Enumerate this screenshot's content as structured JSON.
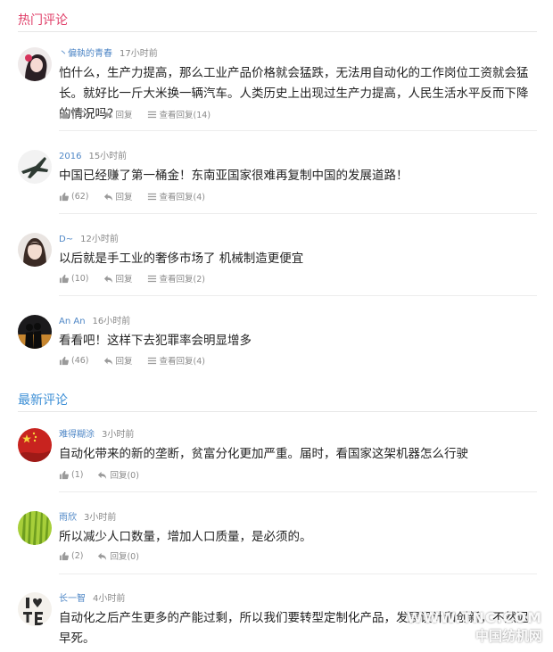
{
  "sections": {
    "hot_title": "热门评论",
    "new_title": "最新评论"
  },
  "labels": {
    "reply": "回复"
  },
  "hot_comments": [
    {
      "username": "丶偏執的青春",
      "time": "17小时前",
      "text": "怕什么，生产力提高，那么工业产品价格就会猛跌，无法用自动化的工作岗位工资就会猛长。就好比一斤大米换一辆汽车。人类历史上出现过生产力提高，人民生活水平反而下降的情况吗？",
      "likes": "(50)",
      "view_replies": "查看回复(14)",
      "avatar_icon": "anime-girl-avatar-icon"
    },
    {
      "username": "2016",
      "time": "15小时前",
      "text": "中国已经赚了第一桶金！东南亚国家很难再复制中国的发展道路！",
      "likes": "(62)",
      "view_replies": "查看回复(4)",
      "avatar_icon": "fighter-jet-avatar-icon"
    },
    {
      "username": "D~",
      "time": "12小时前",
      "text": "以后就是手工业的奢侈市场了 机械制造更便宜",
      "likes": "(10)",
      "view_replies": "查看回复(2)",
      "avatar_icon": "woman-portrait-avatar-icon"
    },
    {
      "username": "An An",
      "time": "16小时前",
      "text": "看看吧！这样下去犯罪率会明显增多",
      "likes": "(46)",
      "view_replies": "查看回复(4)",
      "avatar_icon": "sunset-couple-avatar-icon"
    }
  ],
  "new_comments": [
    {
      "username": "难得糊涂",
      "time": "3小时前",
      "text": "自动化带来的新的垄断，贫富分化更加严重。届时，看国家这架机器怎么行驶",
      "likes": "(1)",
      "replies": "回复(0)",
      "avatar_icon": "china-flag-avatar-icon"
    },
    {
      "username": "雨欣",
      "time": "3小时前",
      "text": "所以减少人口数量，增加人口质量，是必须的。",
      "likes": "(2)",
      "replies": "回复(0)",
      "avatar_icon": "green-grass-avatar-icon"
    },
    {
      "username": "长一智",
      "time": "4小时前",
      "text": "自动化之后产生更多的产能过剩，所以我们要转型定制化产品，发展设计和创新，不然迟早死。",
      "avatar_icon": "i-love-tea-avatar-icon"
    }
  ],
  "watermark": {
    "line1": "WWW.TNC.COM",
    "line2": "中国纺机网"
  },
  "colors": {
    "hot_title": "#e0406a",
    "new_title": "#3d8fd6",
    "username": "#4f87c6",
    "meta": "#888888"
  }
}
